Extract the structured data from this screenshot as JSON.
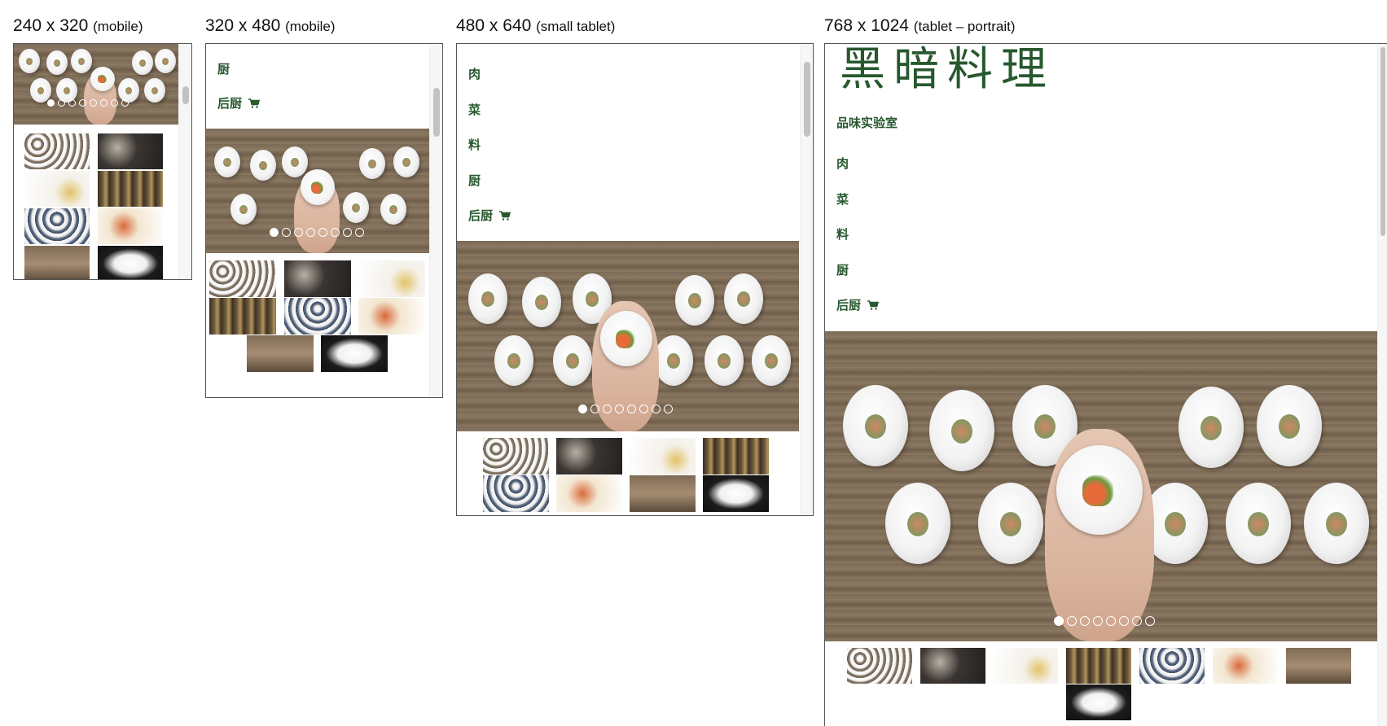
{
  "viewports": [
    {
      "size": "240 x 320",
      "label": "(mobile)"
    },
    {
      "size": "320 x 480",
      "label": "(mobile)"
    },
    {
      "size": "480 x 640",
      "label": "(small tablet)"
    },
    {
      "size": "768 x 1024",
      "label": "(tablet – portrait)"
    }
  ],
  "brand": {
    "title": "黑暗料理",
    "subtitle": "品味实验室"
  },
  "nav": {
    "meat": "肉",
    "veg": "菜",
    "ingredients": "料",
    "chef": "厨",
    "kitchen": "后厨"
  },
  "carousel": {
    "slide_count": 8,
    "active_index": 0
  },
  "colors": {
    "brand_green": "#27582e",
    "frame_border": "#555555"
  },
  "icons": {
    "cart": "shopping-cart-icon"
  }
}
